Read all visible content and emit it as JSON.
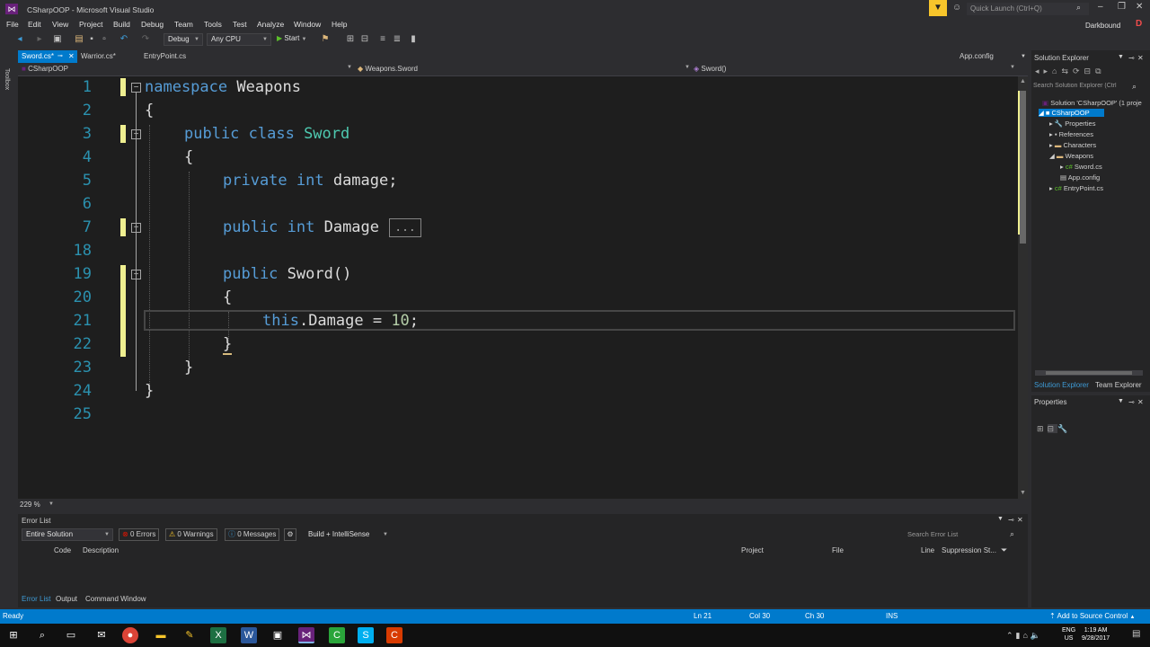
{
  "window": {
    "title": "CSharpOOP - Microsoft Visual Studio",
    "quick_launch_placeholder": "Quick Launch (Ctrl+Q)",
    "user": "Darkbound",
    "user_initial": "D"
  },
  "menu": [
    "File",
    "Edit",
    "View",
    "Project",
    "Build",
    "Debug",
    "Team",
    "Tools",
    "Test",
    "Analyze",
    "Window",
    "Help"
  ],
  "toolbar": {
    "config": "Debug",
    "platform": "Any CPU",
    "start_label": "Start"
  },
  "left_strip": {
    "toolbox_label": "Toolbox"
  },
  "editor_tabs": [
    {
      "label": "Sword.cs*"
    },
    {
      "label": "Warrior.cs*"
    },
    {
      "label": "EntryPoint.cs"
    }
  ],
  "right_tab": "App.config",
  "nav": {
    "project": "CSharpOOP",
    "class": "Weapons.Sword",
    "member": "Sword()"
  },
  "code": {
    "line_numbers": [
      "1",
      "2",
      "3",
      "4",
      "5",
      "6",
      "7",
      "18",
      "19",
      "20",
      "21",
      "22",
      "23",
      "24",
      "25"
    ],
    "l1_kw": "namespace",
    "l1_name": " Weapons",
    "brace_open": "{",
    "brace_close": "}",
    "l3_kw": "public class",
    "l3_type": " Sword",
    "l5_kw": "private int",
    "l5_rest": " damage;",
    "l7_kw": "public int",
    "l7_rest": " Damage",
    "l7_collapsed": "...",
    "l19_kw": "public",
    "l19_rest": " Sword()",
    "l21_kw": "this",
    "l21_mid": ".Damage = ",
    "l21_num": "10",
    "l21_end": ";"
  },
  "zoom": "229 %",
  "error_list": {
    "title": "Error List",
    "scope": "Entire Solution",
    "errors": "0 Errors",
    "warnings": "0 Warnings",
    "messages": "0 Messages",
    "build_filter": "Build + IntelliSense",
    "search_placeholder": "Search Error List",
    "columns": [
      "Code",
      "Description",
      "Project",
      "File",
      "Line",
      "Suppression St..."
    ],
    "bottom_tabs": [
      "Error List",
      "Output",
      "Command Window"
    ]
  },
  "solution_explorer": {
    "title": "Solution Explorer",
    "search_placeholder": "Search Solution Explorer (Ctrl",
    "items": [
      {
        "label": "Solution 'CSharpOOP' (1 proje"
      },
      {
        "label": "CSharpOOP"
      },
      {
        "label": "Properties"
      },
      {
        "label": "References"
      },
      {
        "label": "Characters"
      },
      {
        "label": "Weapons"
      },
      {
        "label": "Sword.cs"
      },
      {
        "label": "App.config"
      },
      {
        "label": "EntryPoint.cs"
      }
    ],
    "tabs": [
      "Solution Explorer",
      "Team Explorer"
    ]
  },
  "properties": {
    "title": "Properties"
  },
  "status": {
    "left": "Ready",
    "ln": "Ln 21",
    "col": "Col 30",
    "ch": "Ch 30",
    "ins": "INS",
    "source_control": "Add to Source Control"
  },
  "taskbar": {
    "lang": "ENG",
    "region": "US",
    "time": "1:19 AM",
    "date": "9/28/2017"
  }
}
